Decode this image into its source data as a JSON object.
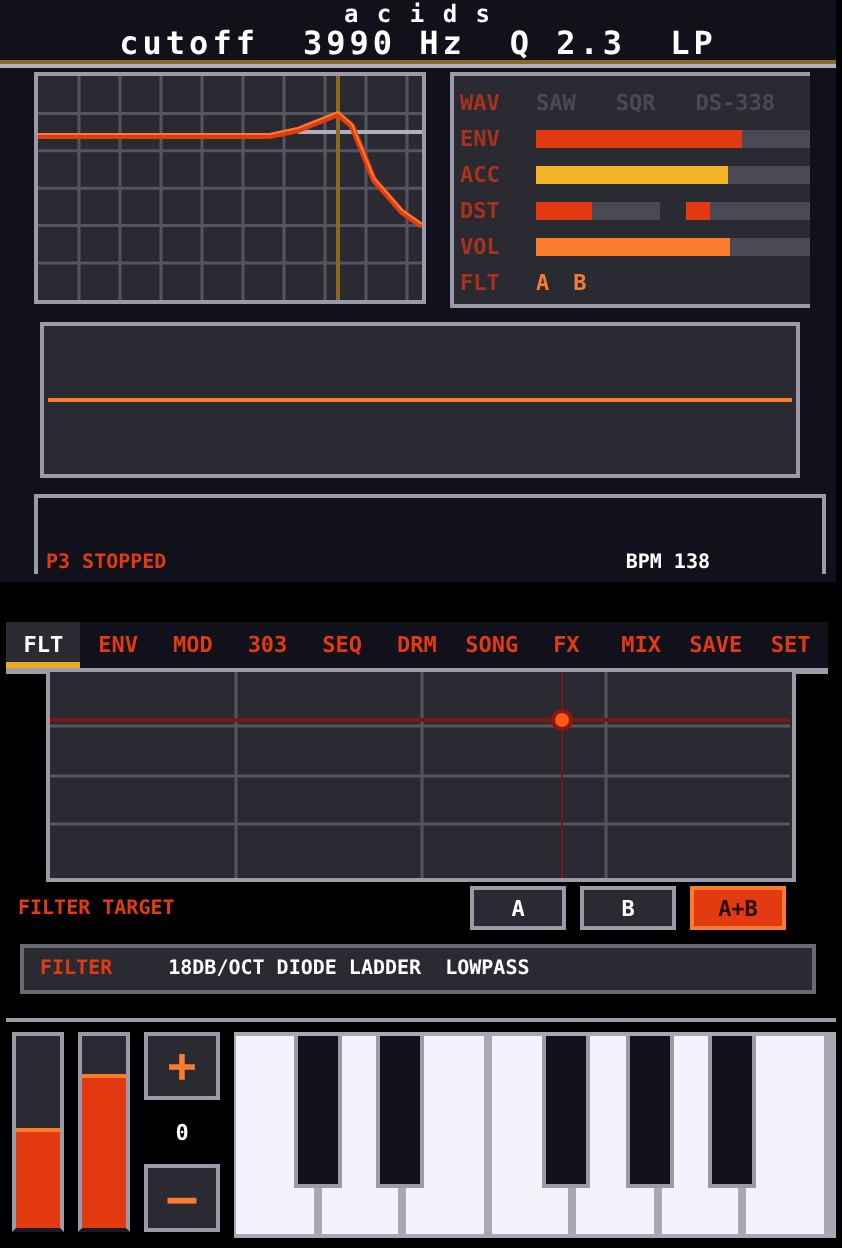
{
  "header": {
    "title": "a c i d s",
    "readout": [
      "cutoff",
      "3990 Hz",
      "Q 2.3",
      "LP"
    ]
  },
  "synth_rows": [
    {
      "kind": "options",
      "label": "WAV",
      "options": [
        "SAW",
        "SQR",
        "DS-338"
      ]
    },
    {
      "kind": "bar",
      "label": "ENV",
      "bars": [
        {
          "level": 0.75,
          "color": "#e33a12"
        }
      ]
    },
    {
      "kind": "bar",
      "label": "ACC",
      "bars": [
        {
          "level": 0.7,
          "color": "#f2b324"
        }
      ]
    },
    {
      "kind": "bar",
      "label": "DST",
      "bars": [
        {
          "level": 0.45,
          "color": "#e33a12"
        },
        {
          "level": 0.2,
          "color": "#e33a12"
        }
      ]
    },
    {
      "kind": "bar",
      "label": "VOL",
      "bars": [
        {
          "level": 0.71,
          "color": "#fb7c2c"
        }
      ]
    },
    {
      "kind": "options_lit",
      "label": "FLT",
      "options": [
        "A",
        "B"
      ]
    }
  ],
  "status": {
    "state": "P3 STOPPED",
    "bpm": "BPM 138"
  },
  "tabs": [
    {
      "label": "FLT",
      "selected": true
    },
    {
      "label": "ENV",
      "selected": false
    },
    {
      "label": "MOD",
      "selected": false
    },
    {
      "label": "303",
      "selected": false
    },
    {
      "label": "SEQ",
      "selected": false
    },
    {
      "label": "DRM",
      "selected": false
    },
    {
      "label": "SONG",
      "selected": false
    },
    {
      "label": "FX",
      "selected": false
    },
    {
      "label": "MIX",
      "selected": false
    },
    {
      "label": "SAVE",
      "selected": false
    },
    {
      "label": "SET",
      "selected": false
    }
  ],
  "filter_target": {
    "label": "FILTER TARGET",
    "buttons": [
      {
        "label": "A",
        "selected": false
      },
      {
        "label": "B",
        "selected": false
      },
      {
        "label": "A+B",
        "selected": true
      }
    ]
  },
  "filter_info": {
    "label": "FILTER",
    "value": "18DB/OCT DIODE LADDER  LOWPASS"
  },
  "sliders": [
    {
      "level": 0.5
    },
    {
      "level": 0.78
    }
  ],
  "octave": {
    "plus": "+",
    "value": "0",
    "minus": "—"
  }
}
